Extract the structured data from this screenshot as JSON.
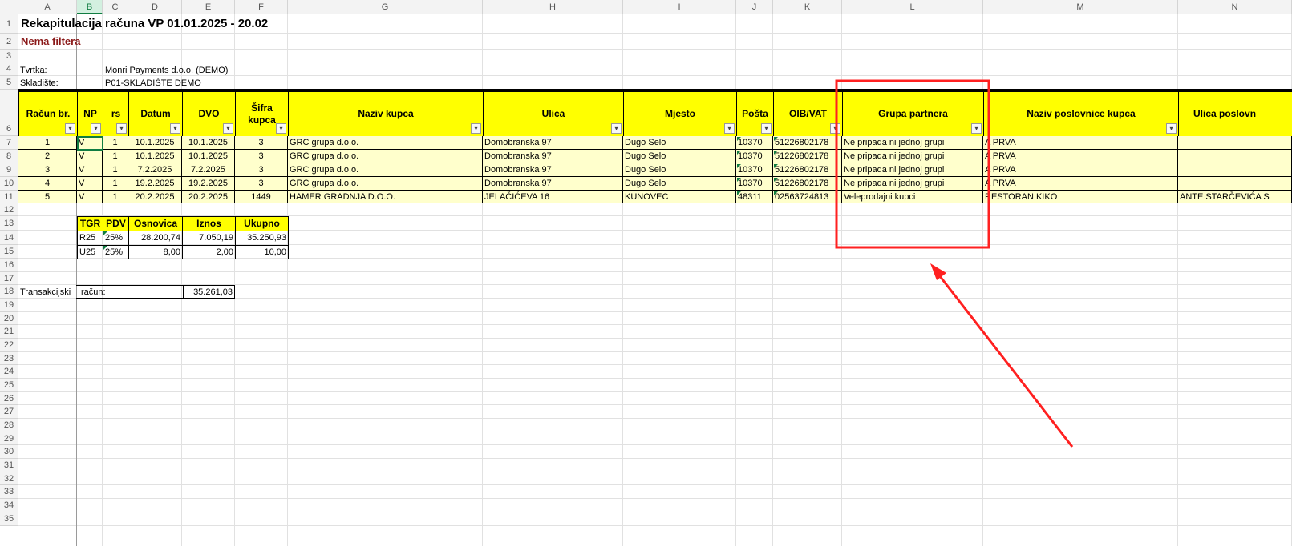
{
  "columns": [
    "A",
    "B",
    "C",
    "D",
    "E",
    "F",
    "G",
    "H",
    "I",
    "J",
    "K",
    "L",
    "M",
    "N"
  ],
  "row_numbers": [
    "1",
    "2",
    "3",
    "4",
    "5",
    "6",
    "7",
    "8",
    "9",
    "10",
    "11",
    "12",
    "13",
    "14",
    "15",
    "16",
    "17",
    "18",
    "19",
    "20",
    "21",
    "22",
    "23",
    "24",
    "25",
    "26",
    "27",
    "28",
    "29",
    "30",
    "31",
    "32",
    "33",
    "34",
    "35"
  ],
  "title": "Rekapitulacija računa VP 01.01.2025 - 20.02",
  "filter_note": "Nema filtera",
  "company_label": "Tvrtka:",
  "company_value": "Monri Payments d.o.o. (DEMO)",
  "warehouse_label": "Skladište:",
  "warehouse_value": "P01-SKLADIŠTE DEMO",
  "headers": {
    "racun": "Račun br.",
    "np": "NP",
    "rs": "rs",
    "datum": "Datum",
    "dvo": "DVO",
    "sifra1": "Šifra",
    "sifra2": "kupca",
    "naziv": "Naziv kupca",
    "ulica": "Ulica",
    "mjesto": "Mjesto",
    "posta": "Pošta",
    "oib": "OIB/VAT",
    "grupa": "Grupa partnera",
    "poslovnica": "Naziv poslovnice kupca",
    "ulica_posl": "Ulica poslovn"
  },
  "rows": [
    {
      "racun": "1",
      "np": "V",
      "rs": "1",
      "datum": "10.1.2025",
      "dvo": "10.1.2025",
      "sifra": "3",
      "naziv": "GRC grupa d.o.o.",
      "ulica": "Domobranska 97",
      "mjesto": "Dugo Selo",
      "posta": "10370",
      "oib": "51226802178",
      "grupa": "Ne pripada ni jednoj grupi",
      "poslovnica": "A PRVA",
      "ulica_posl": ""
    },
    {
      "racun": "2",
      "np": "V",
      "rs": "1",
      "datum": "10.1.2025",
      "dvo": "10.1.2025",
      "sifra": "3",
      "naziv": "GRC grupa d.o.o.",
      "ulica": "Domobranska 97",
      "mjesto": "Dugo Selo",
      "posta": "10370",
      "oib": "51226802178",
      "grupa": "Ne pripada ni jednoj grupi",
      "poslovnica": "A PRVA",
      "ulica_posl": ""
    },
    {
      "racun": "3",
      "np": "V",
      "rs": "1",
      "datum": "7.2.2025",
      "dvo": "7.2.2025",
      "sifra": "3",
      "naziv": "GRC grupa d.o.o.",
      "ulica": "Domobranska 97",
      "mjesto": "Dugo Selo",
      "posta": "10370",
      "oib": "51226802178",
      "grupa": "Ne pripada ni jednoj grupi",
      "poslovnica": "A PRVA",
      "ulica_posl": ""
    },
    {
      "racun": "4",
      "np": "V",
      "rs": "1",
      "datum": "19.2.2025",
      "dvo": "19.2.2025",
      "sifra": "3",
      "naziv": "GRC grupa d.o.o.",
      "ulica": "Domobranska 97",
      "mjesto": "Dugo Selo",
      "posta": "10370",
      "oib": "51226802178",
      "grupa": "Ne pripada ni jednoj grupi",
      "poslovnica": "A PRVA",
      "ulica_posl": ""
    },
    {
      "racun": "5",
      "np": "V",
      "rs": "1",
      "datum": "20.2.2025",
      "dvo": "20.2.2025",
      "sifra": "1449",
      "naziv": "HAMER GRADNJA D.O.O.",
      "ulica": "JELAČIĆEVA 16",
      "mjesto": "KUNOVEC",
      "posta": "48311",
      "oib": "02563724813",
      "grupa": "Veleprodajni kupci",
      "poslovnica": "RESTORAN KIKO",
      "ulica_posl": "ANTE STARČEVIĆA S"
    }
  ],
  "tax_table": {
    "headers": [
      "TGR",
      "PDV",
      "Osnovica",
      "Iznos",
      "Ukupno"
    ],
    "rows": [
      [
        "R25",
        "25%",
        "28.200,74",
        "7.050,19",
        "35.250,93"
      ],
      [
        "U25",
        "25%",
        "8,00",
        "2,00",
        "10,00"
      ]
    ]
  },
  "transaction_label_a": "Transakcijski",
  "transaction_label_b": "račun:",
  "transaction_value": "35.261,03",
  "annotation_color": "#ff0000"
}
